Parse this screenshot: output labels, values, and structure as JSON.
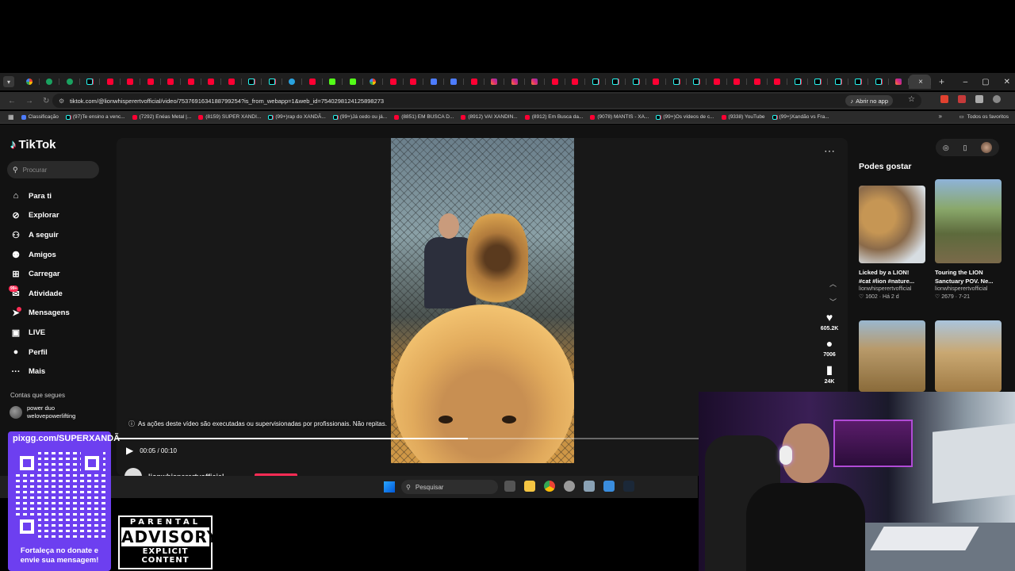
{
  "browser": {
    "tabs": [
      "g",
      "gr",
      "gr",
      "tt",
      "yt",
      "yt",
      "yt",
      "yt",
      "yt",
      "yt",
      "yt",
      "tt",
      "tt",
      "tg",
      "yt",
      "kk",
      "kk",
      "g",
      "yt",
      "yt",
      "bl",
      "bl",
      "yt",
      "ig",
      "ig",
      "ig",
      "yt",
      "yt",
      "tt",
      "tt",
      "tt",
      "yt",
      "tt",
      "tt",
      "yt",
      "yt",
      "yt",
      "yt",
      "tt",
      "tt",
      "tt",
      "tt",
      "tt",
      "ig"
    ],
    "active_tab_close": "×",
    "new_tab": "+",
    "window_controls": [
      "–",
      "▢",
      "✕"
    ],
    "url": "tiktok.com/@lionwhisperertvofficial/video/7537691634188799254?is_from_webapp=1&web_id=7540298124125898273",
    "open_app_label": "Abrir no app",
    "bookmarks": [
      {
        "label": "Classificação",
        "icon": "bl"
      },
      {
        "label": "(97)Te ensino a venc...",
        "icon": "tt"
      },
      {
        "label": "(7292) Enéas Metal |...",
        "icon": "yt"
      },
      {
        "label": "(8159) SUPER XANDI...",
        "icon": "yt"
      },
      {
        "label": "(99+)rap do XANDÃ...",
        "icon": "tt"
      },
      {
        "label": "(99+)Já cedo ou já...",
        "icon": "tt"
      },
      {
        "label": "(8851) EM BUSCA D...",
        "icon": "yt"
      },
      {
        "label": "(8912) VAI XANDIN...",
        "icon": "yt"
      },
      {
        "label": "(8912) Em Busca da...",
        "icon": "yt"
      },
      {
        "label": "(9078) MANTIS - XA...",
        "icon": "yt"
      },
      {
        "label": "(99+)Os vídeos de c...",
        "icon": "tt"
      },
      {
        "label": "(9338) YouTube",
        "icon": "yt"
      },
      {
        "label": "(99+)Xandão vs Fra...",
        "icon": "tt"
      }
    ],
    "bookmarks_more": "»",
    "all_bookmarks": "Todos os favoritos"
  },
  "tiktok": {
    "logo": "TikTok",
    "search_placeholder": "Procurar",
    "nav": [
      {
        "label": "Para ti",
        "icon": "⌂"
      },
      {
        "label": "Explorar",
        "icon": "⊘"
      },
      {
        "label": "A seguir",
        "icon": "⚇"
      },
      {
        "label": "Amigos",
        "icon": "⚉"
      },
      {
        "label": "Carregar",
        "icon": "⊞"
      },
      {
        "label": "Atividade",
        "icon": "✉",
        "badge": "99+"
      },
      {
        "label": "Mensagens",
        "icon": "➤",
        "badge": "1"
      },
      {
        "label": "LIVE",
        "icon": "▣"
      },
      {
        "label": "Perfil",
        "icon": "●"
      },
      {
        "label": "Mais",
        "icon": "···"
      }
    ],
    "following_title": "Contas que segues",
    "following_user": "power duo",
    "following_handle": "welovepowerlifting",
    "video": {
      "caption": "As ações deste vídeo são executadas ou supervisionadas por profissionais. Não repitas.",
      "time": "00:05 / 00:10",
      "progress": 0.48,
      "author": "lionwhisperertvofficial",
      "likes": "605.2K",
      "comments": "7006",
      "saves": "24K"
    },
    "suggest_title": "Podes gostar",
    "suggestions": [
      {
        "title": "Licked by a LION!",
        "title2": "#cat #lion #nature...",
        "author": "lionwhisperertvofficial",
        "meta": "♡ 1602 · Há 2 d"
      },
      {
        "title": "Touring the LION",
        "title2": "Sanctuary POV. Ne...",
        "author": "lionwhisperertvofficial",
        "meta": "♡ 2679 · 7-21"
      }
    ]
  },
  "taskbar": {
    "search_placeholder": "Pesquisar"
  },
  "overlays": {
    "qr_url": "pixgg.com/SUPERXANDÃ",
    "qr_message_1": "Fortaleça no donate e",
    "qr_message_2": "envie sua mensagem!",
    "advisory_1": "PARENTAL",
    "advisory_2": "ADVISORY",
    "advisory_3": "EXPLICIT CONTENT"
  }
}
